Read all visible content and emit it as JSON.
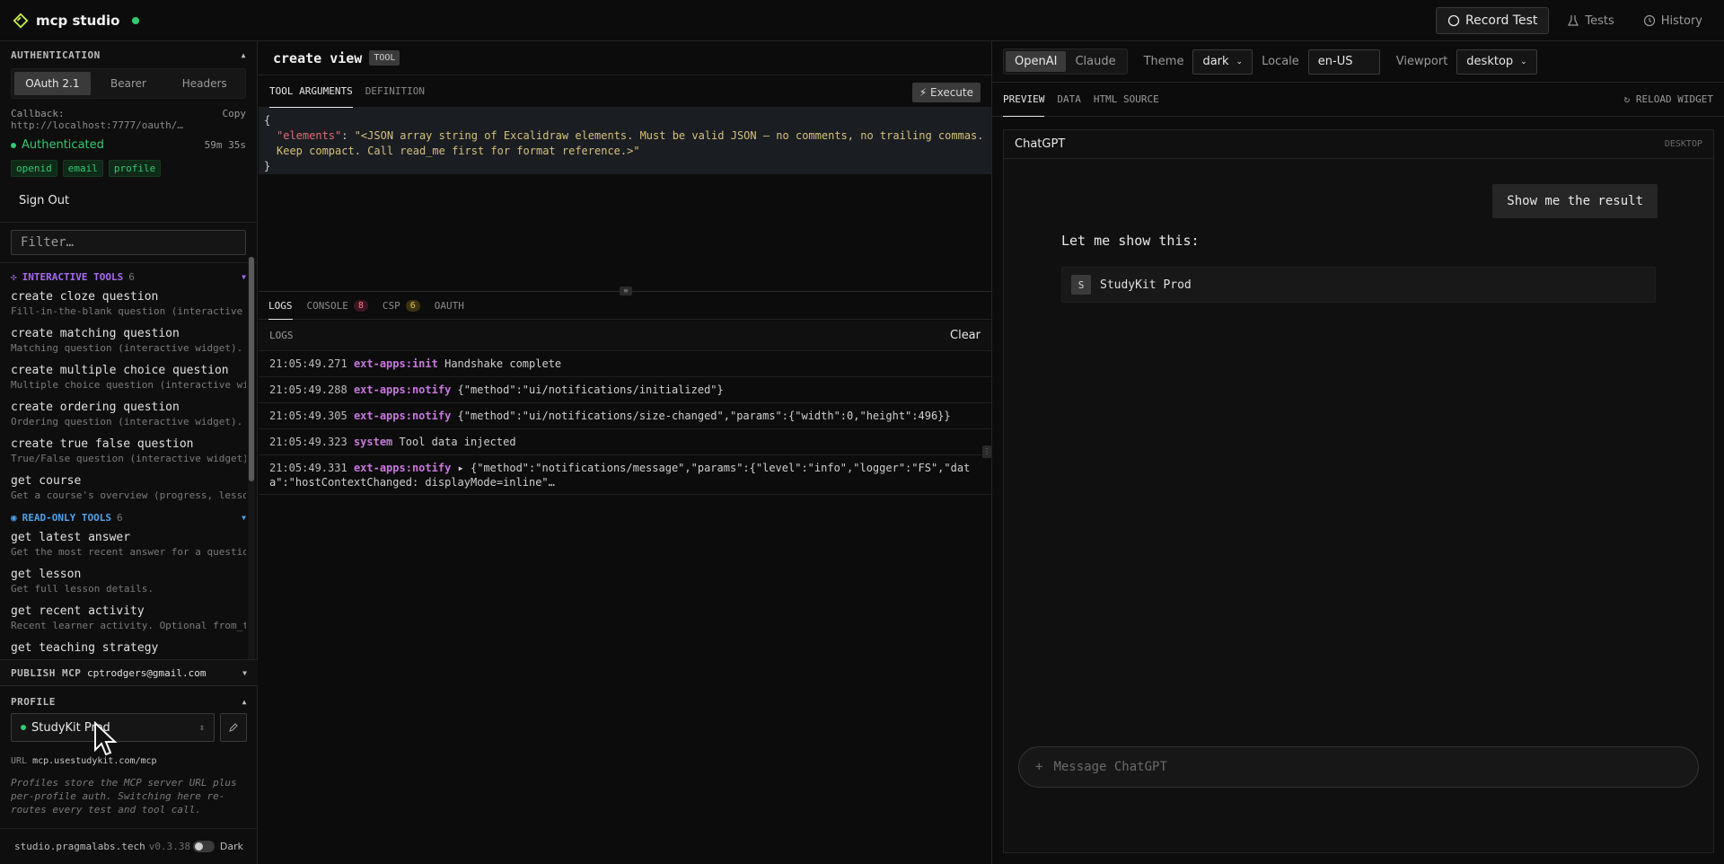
{
  "app": {
    "title": "mcp studio"
  },
  "topbar": {
    "record_label": "Record Test",
    "tests_label": "Tests",
    "history_label": "History"
  },
  "auth": {
    "section_title": "AUTHENTICATION",
    "tabs": [
      "OAuth 2.1",
      "Bearer",
      "Headers"
    ],
    "callback_label": "Callback:",
    "callback_value": "http://localhost:7777/oauth/…",
    "copy_label": "Copy",
    "status": "Authenticated",
    "time": "59m 35s",
    "scopes": [
      "openid",
      "email",
      "profile"
    ],
    "signout_label": "Sign Out"
  },
  "filter": {
    "placeholder": "Filter…"
  },
  "tool_groups": {
    "interactive": {
      "label": "INTERACTIVE TOOLS",
      "count": "6"
    },
    "readonly": {
      "label": "READ-ONLY TOOLS",
      "count": "6"
    }
  },
  "interactive_tools": [
    {
      "name": "create cloze question",
      "desc": "Fill-in-the-blank question (interactive …"
    },
    {
      "name": "create matching question",
      "desc": "Matching question (interactive widget). …"
    },
    {
      "name": "create multiple choice question",
      "desc": "Multiple choice question (interactive wi…"
    },
    {
      "name": "create ordering question",
      "desc": "Ordering question (interactive widget). …"
    },
    {
      "name": "create true false question",
      "desc": "True/False question (interactive widget)…"
    },
    {
      "name": "get course",
      "desc": "Get a course's overview (progress, lesso…"
    }
  ],
  "readonly_tools": [
    {
      "name": "get latest answer",
      "desc": "Get the most recent answer for a questio…"
    },
    {
      "name": "get lesson",
      "desc": "Get full lesson details."
    },
    {
      "name": "get recent activity",
      "desc": "Recent learner activity. Optional from_t…"
    },
    {
      "name": "get teaching strategy",
      "desc": ""
    }
  ],
  "publish": {
    "label": "PUBLISH MCP",
    "email": "cptrodgers@gmail.com"
  },
  "profile": {
    "section_title": "PROFILE",
    "selected": "StudyKit Prod",
    "url_label": "URL",
    "url_value": "mcp.usestudykit.com/mcp",
    "note": "Profiles store the MCP server URL plus per-profile auth. Switching here re-routes every test and tool call."
  },
  "footer": {
    "site": "studio.pragmalabs.tech",
    "version": "v0.3.38",
    "theme_label": "Dark"
  },
  "tool_view": {
    "title": "create view",
    "badge": "TOOL",
    "tabs": [
      "TOOL ARGUMENTS",
      "DEFINITION"
    ],
    "execute_label": "⚡ Execute",
    "code_open": "{",
    "code_key": "\"elements\"",
    "code_colon": ": ",
    "code_value": "\"<JSON array string of Excalidraw elements. Must be valid JSON — no comments, no trailing commas. Keep compact. Call read_me first for format reference.>\"",
    "code_close": "}"
  },
  "log_tabs": {
    "logs": "LOGS",
    "console": "CONSOLE",
    "console_count": "8",
    "csp": "CSP",
    "csp_count": "6",
    "oauth": "OAUTH"
  },
  "logs": {
    "header": "LOGS",
    "clear_label": "Clear",
    "rows": [
      {
        "ts": "21:05:49.271",
        "src": "ext-apps:init",
        "msg": "Handshake complete"
      },
      {
        "ts": "21:05:49.288",
        "src": "ext-apps:notify",
        "msg": "{\"method\":\"ui/notifications/initialized\"}"
      },
      {
        "ts": "21:05:49.305",
        "src": "ext-apps:notify",
        "msg": "{\"method\":\"ui/notifications/size-changed\",\"params\":{\"width\":0,\"height\":496}}"
      },
      {
        "ts": "21:05:49.323",
        "src": "system",
        "msg": "Tool data injected"
      },
      {
        "ts": "21:05:49.331",
        "src": "ext-apps:notify",
        "msg": "▸ {\"method\":\"notifications/message\",\"params\":{\"level\":\"info\",\"logger\":\"FS\",\"data\":\"hostContextChanged: displayMode=inline\"…"
      }
    ]
  },
  "preview_opts": {
    "hosts": [
      "OpenAI",
      "Claude"
    ],
    "theme_label": "Theme",
    "theme_value": "dark",
    "locale_label": "Locale",
    "locale_value": "en-US",
    "viewport_label": "Viewport",
    "viewport_value": "desktop"
  },
  "preview_tabs": {
    "tabs": [
      "PREVIEW",
      "DATA",
      "HTML SOURCE"
    ],
    "reload_label": "↻ RELOAD WIDGET"
  },
  "preview": {
    "app_name": "ChatGPT",
    "mode": "DESKTOP",
    "user_msg": "Show me the result",
    "assistant_msg": "Let me show this:",
    "widget_avatar": "S",
    "widget_title": "StudyKit Prod",
    "composer_placeholder": "Message ChatGPT",
    "composer_plus": "+"
  },
  "colors": {
    "accent_green": "#2ecc71",
    "logo": "#c6f24a",
    "purple": "#a66af0",
    "blue": "#4ea1ea"
  }
}
